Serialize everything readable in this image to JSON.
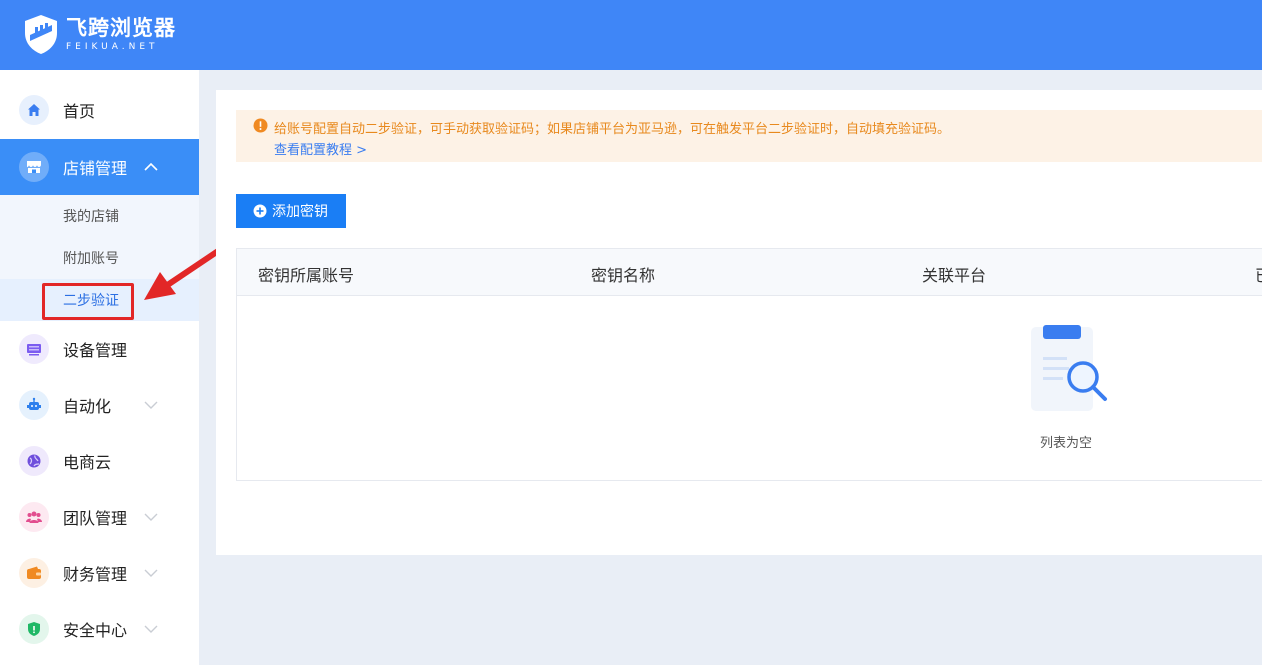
{
  "app": {
    "title": "飞跨浏览器",
    "subtitle": "FEIKUA.NET",
    "brand_color": "#3f86f7"
  },
  "sidebar": {
    "items": [
      {
        "label": "首页",
        "icon": "home-icon"
      },
      {
        "label": "店铺管理",
        "icon": "store-icon",
        "expanded": true
      },
      {
        "label": "设备管理",
        "icon": "device-icon"
      },
      {
        "label": "自动化",
        "icon": "robot-icon"
      },
      {
        "label": "电商云",
        "icon": "cloud-globe-icon"
      },
      {
        "label": "团队管理",
        "icon": "team-icon"
      },
      {
        "label": "财务管理",
        "icon": "wallet-icon"
      },
      {
        "label": "安全中心",
        "icon": "shield-icon"
      }
    ],
    "store_sub": [
      {
        "label": "我的店铺"
      },
      {
        "label": "附加账号"
      },
      {
        "label": "二步验证",
        "active": true
      }
    ]
  },
  "notice": {
    "text": "给账号配置自动二步验证，可手动获取验证码；如果店铺平台为亚马逊，可在触发平台二步验证时，自动填充验证码。",
    "link": "查看配置教程 >"
  },
  "toolbar": {
    "add_label": "添加密钥"
  },
  "table": {
    "columns": [
      "密钥所属账号",
      "密钥名称",
      "关联平台",
      "已"
    ],
    "empty_text": "列表为空"
  }
}
